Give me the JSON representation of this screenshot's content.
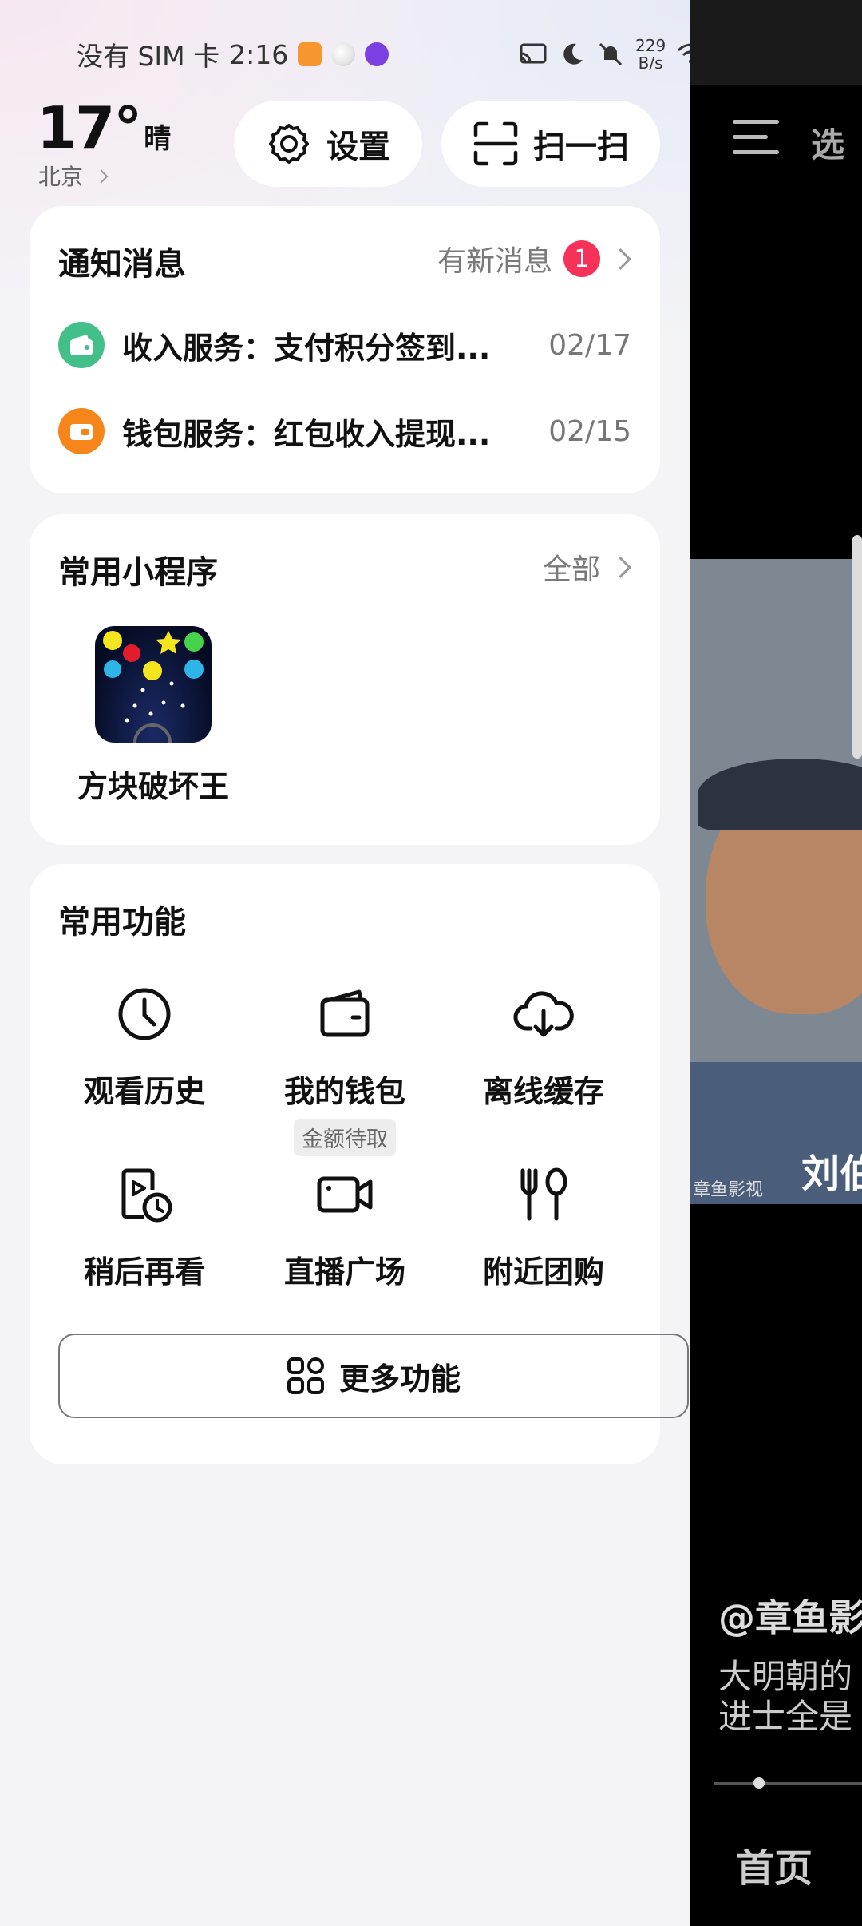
{
  "status_bar": {
    "carrier": "没有 SIM 卡",
    "time": "2:16",
    "speed_value": "229",
    "speed_unit": "B/s"
  },
  "weather": {
    "temperature": "17°",
    "condition": "晴",
    "city": "北京"
  },
  "quick_actions": {
    "settings_label": "设置",
    "scan_label": "扫一扫"
  },
  "notifications": {
    "title": "通知消息",
    "more_label": "有新消息",
    "badge_count": "1",
    "items": [
      {
        "text": "收入服务：支付积分签到...",
        "date": "02/17",
        "icon": "wallet-icon",
        "color": "#43c08a"
      },
      {
        "text": "钱包服务：红包收入提现...",
        "date": "02/15",
        "icon": "wallet-icon",
        "color": "#f7861a"
      }
    ]
  },
  "mini_programs": {
    "title": "常用小程序",
    "more_label": "全部",
    "items": [
      {
        "label": "方块破坏王",
        "icon": "block-breaker-game-icon"
      }
    ]
  },
  "functions": {
    "title": "常用功能",
    "items": [
      {
        "label": "观看历史",
        "icon": "clock-icon"
      },
      {
        "label": "我的钱包",
        "icon": "wallet-icon",
        "sub": "金额待取"
      },
      {
        "label": "离线缓存",
        "icon": "cloud-download-icon"
      },
      {
        "label": "稍后再看",
        "icon": "watch-later-icon"
      },
      {
        "label": "直播广场",
        "icon": "video-camera-icon"
      },
      {
        "label": "附近团购",
        "icon": "fork-spoon-icon"
      }
    ],
    "more_button_label": "更多功能"
  },
  "video_panel": {
    "tab_text": "选",
    "caption": "刘伯",
    "watermark": "章鱼影视",
    "username": "@章鱼影",
    "description_line1": "大明朝的",
    "description_line2": "进士全是",
    "nav_home": "首页"
  }
}
